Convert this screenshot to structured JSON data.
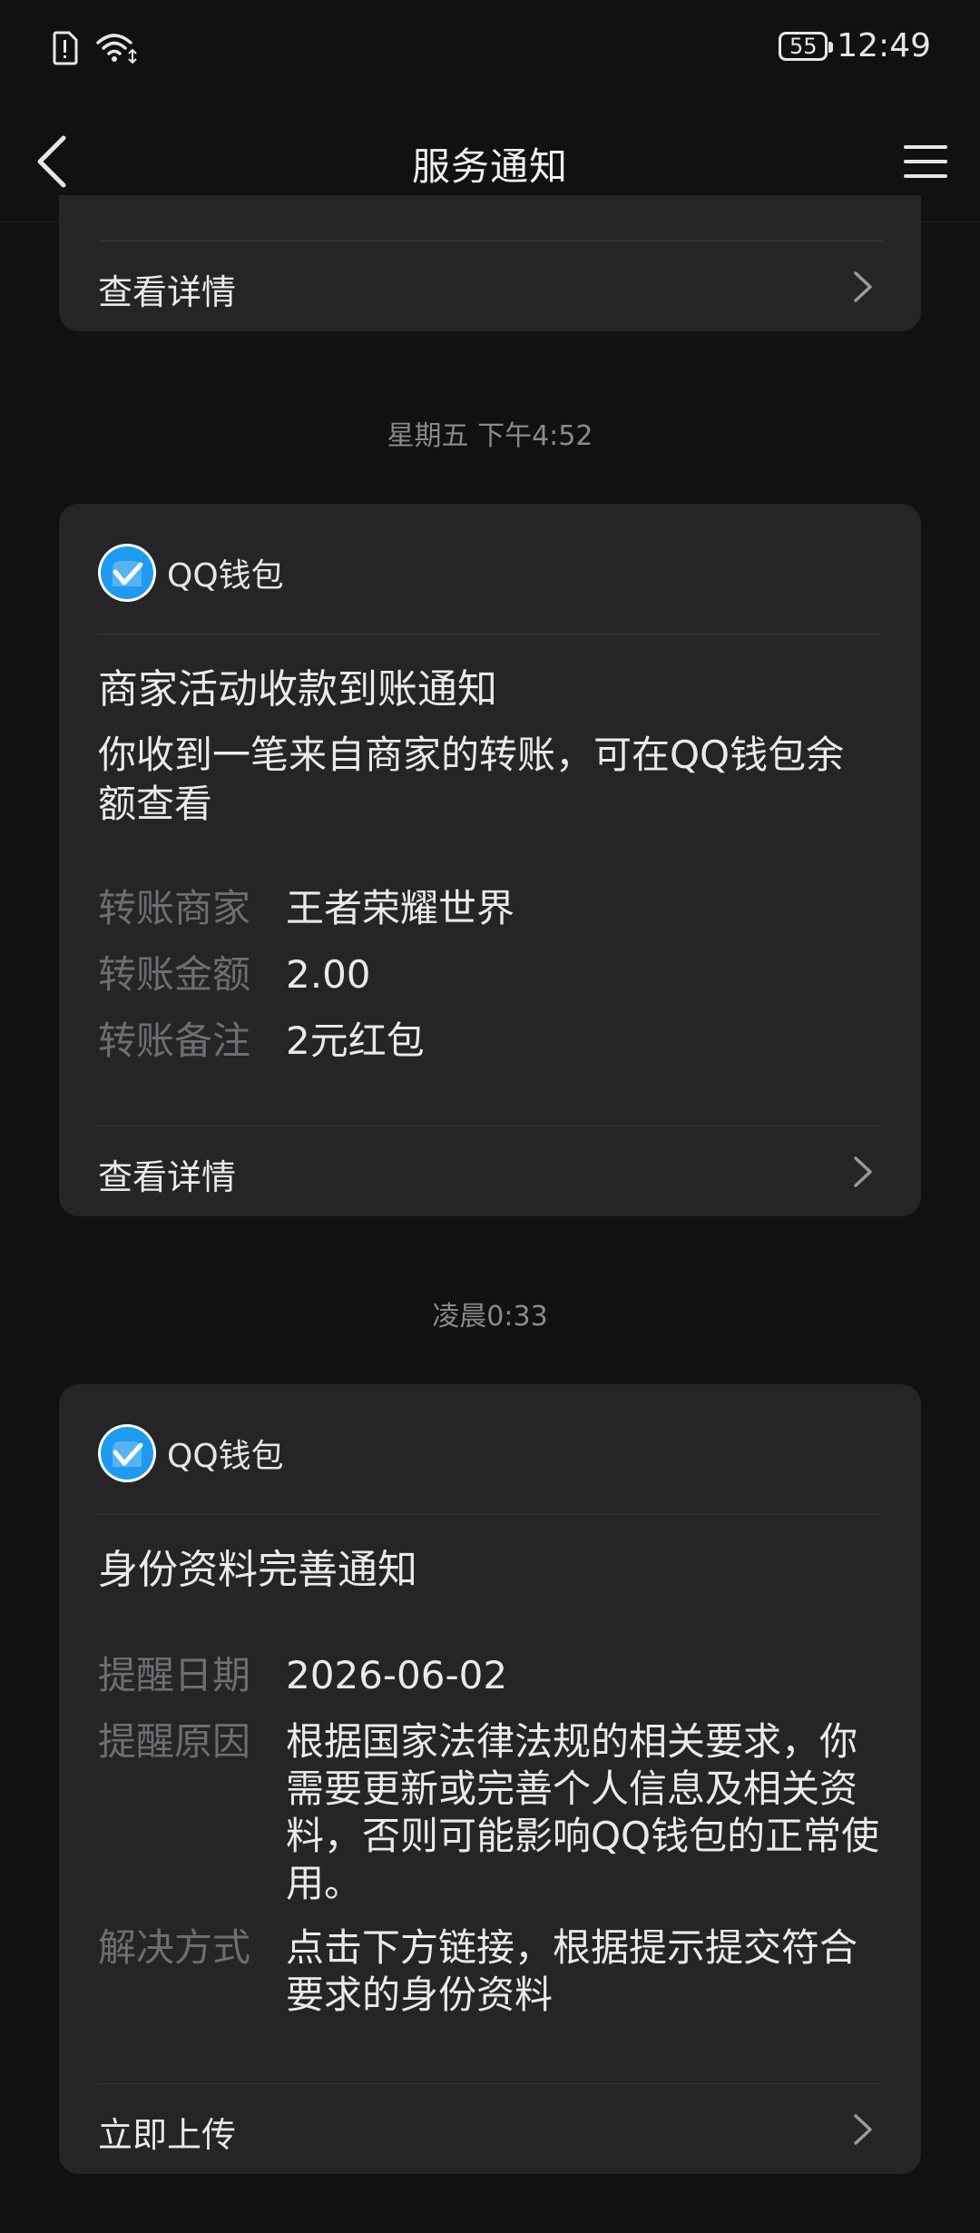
{
  "status_bar": {
    "battery_level": "55",
    "time": "12:49"
  },
  "nav": {
    "title": "服务通知"
  },
  "partial_card": {
    "link_label": "查看详情"
  },
  "messages": [
    {
      "timestamp": "星期五 下午4:52",
      "sender": "QQ钱包",
      "title": "商家活动收款到账通知",
      "description": "你收到一笔来自商家的转账，可在QQ钱包余额查看",
      "fields": [
        {
          "label": "转账商家",
          "value": "王者荣耀世界"
        },
        {
          "label": "转账金额",
          "value": "2.00"
        },
        {
          "label": "转账备注",
          "value": "2元红包"
        }
      ],
      "link_label": "查看详情"
    },
    {
      "timestamp": "凌晨0:33",
      "sender": "QQ钱包",
      "title": "身份资料完善通知",
      "fields": [
        {
          "label": "提醒日期",
          "value": "2026-06-02"
        },
        {
          "label": "提醒原因",
          "value": "根据国家法律法规的相关要求，你需要更新或完善个人信息及相关资料，否则可能影响QQ钱包的正常使用。"
        },
        {
          "label": "解决方式",
          "value": "点击下方链接，根据提示提交符合要求的身份资料"
        }
      ],
      "link_label": "立即上传"
    }
  ],
  "colors": {
    "background": "#111113",
    "card": "#252528",
    "label_gray": "#6e6e72",
    "avatar_blue": "#1e9bf0"
  }
}
